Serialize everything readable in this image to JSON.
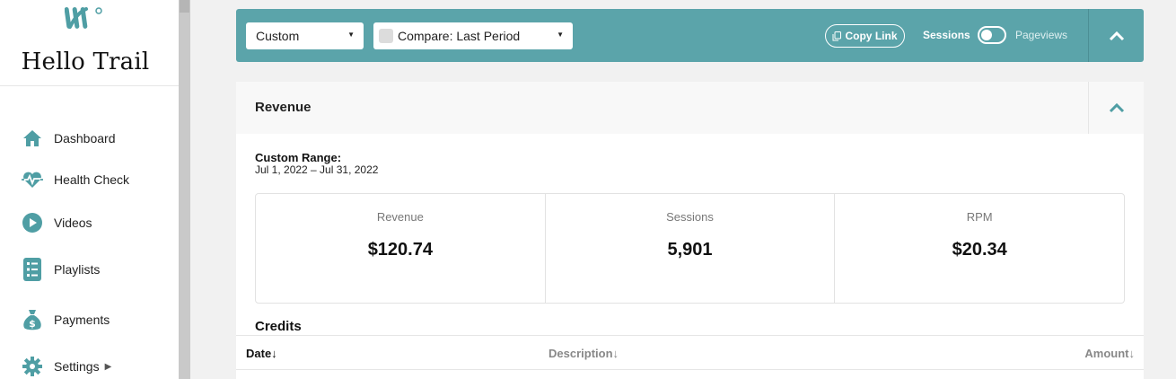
{
  "sidebar": {
    "site_title": "Hello Trail",
    "items": [
      {
        "label": "Dashboard",
        "icon": "home-icon"
      },
      {
        "label": "Health Check",
        "icon": "heartbeat-icon"
      },
      {
        "label": "Videos",
        "icon": "play-circle-icon"
      },
      {
        "label": "Playlists",
        "icon": "list-icon"
      },
      {
        "label": "Payments",
        "icon": "money-bag-icon"
      },
      {
        "label": "Settings",
        "icon": "gear-icon"
      }
    ]
  },
  "filter_bar": {
    "range_select": "Custom",
    "compare_select": "Compare: Last Period",
    "copy_link": "Copy Link",
    "toggle_left": "Sessions",
    "toggle_right": "Pageviews"
  },
  "revenue": {
    "title": "Revenue",
    "range_label": "Custom Range:",
    "range_value": "Jul 1, 2022 – Jul 31, 2022",
    "stats": [
      {
        "label": "Revenue",
        "value": "$120.74"
      },
      {
        "label": "Sessions",
        "value": "5,901"
      },
      {
        "label": "RPM",
        "value": "$20.34"
      }
    ],
    "credits_title": "Credits",
    "columns": [
      "Date↓",
      "Description↓",
      "Amount↓"
    ]
  },
  "colors": {
    "accent": "#5ba4aa",
    "icon": "#4f9ea4"
  }
}
